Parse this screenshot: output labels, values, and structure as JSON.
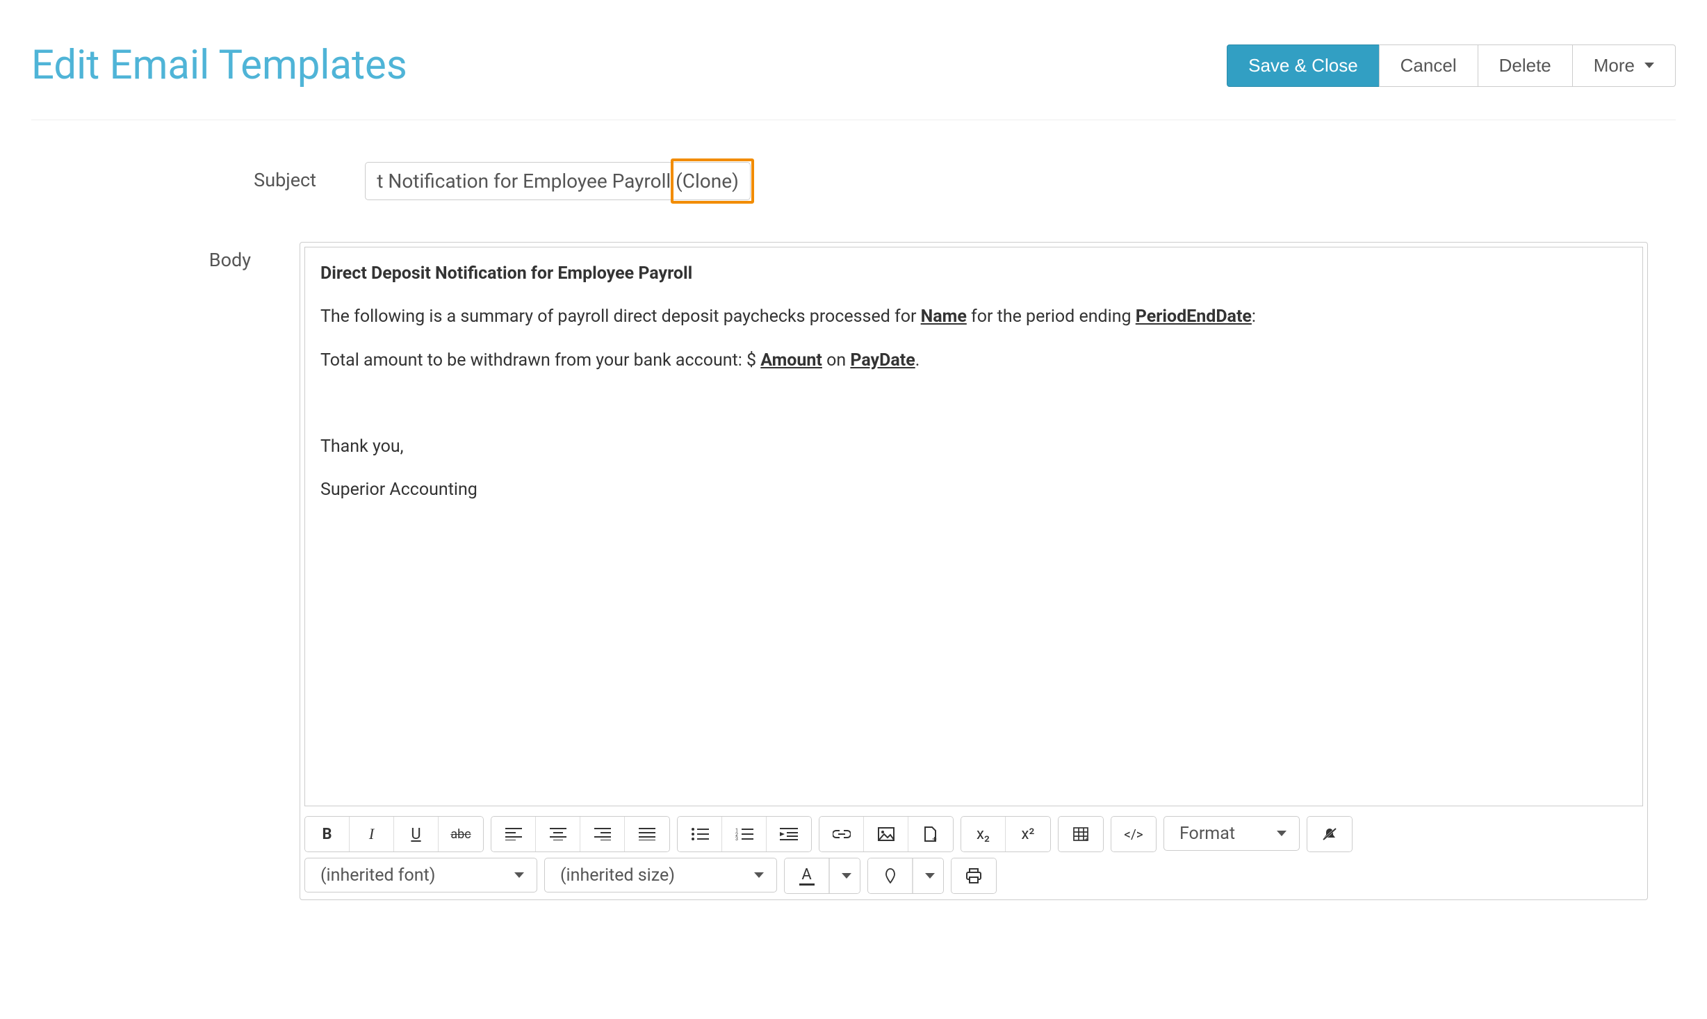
{
  "header": {
    "title": "Edit Email Templates",
    "buttons": {
      "save_close": "Save & Close",
      "cancel": "Cancel",
      "delete": "Delete",
      "more": "More"
    }
  },
  "form": {
    "subject_label": "Subject",
    "subject_value": "Direct Deposit Notification for Employee Payroll (Clone)",
    "subject_visible": "sit Notification for Employee Payroll (Clone)",
    "body_label": "Body",
    "body": {
      "heading": "Direct Deposit Notification for Employee Payroll",
      "line1_pre": "The following is a summary of payroll direct deposit paychecks processed for ",
      "line1_var1": "Name",
      "line1_mid": " for the period ending ",
      "line1_var2": "PeriodEndDate",
      "line1_post": ":",
      "line2_pre": "Total amount to be withdrawn from your bank account:  $ ",
      "line2_var1": "Amount",
      "line2_mid": " on ",
      "line2_var2": "PayDate",
      "line2_post": ".",
      "thank_you": "Thank you,",
      "signature": "Superior Accounting"
    }
  },
  "toolbar": {
    "font_family": "(inherited font)",
    "font_size": "(inherited size)",
    "format": "Format",
    "icons": {
      "bold": "B",
      "italic": "I",
      "underline": "U",
      "strike": "abc",
      "sub": "x₂",
      "sup": "x²",
      "code": "</>",
      "font_color": "A"
    }
  }
}
